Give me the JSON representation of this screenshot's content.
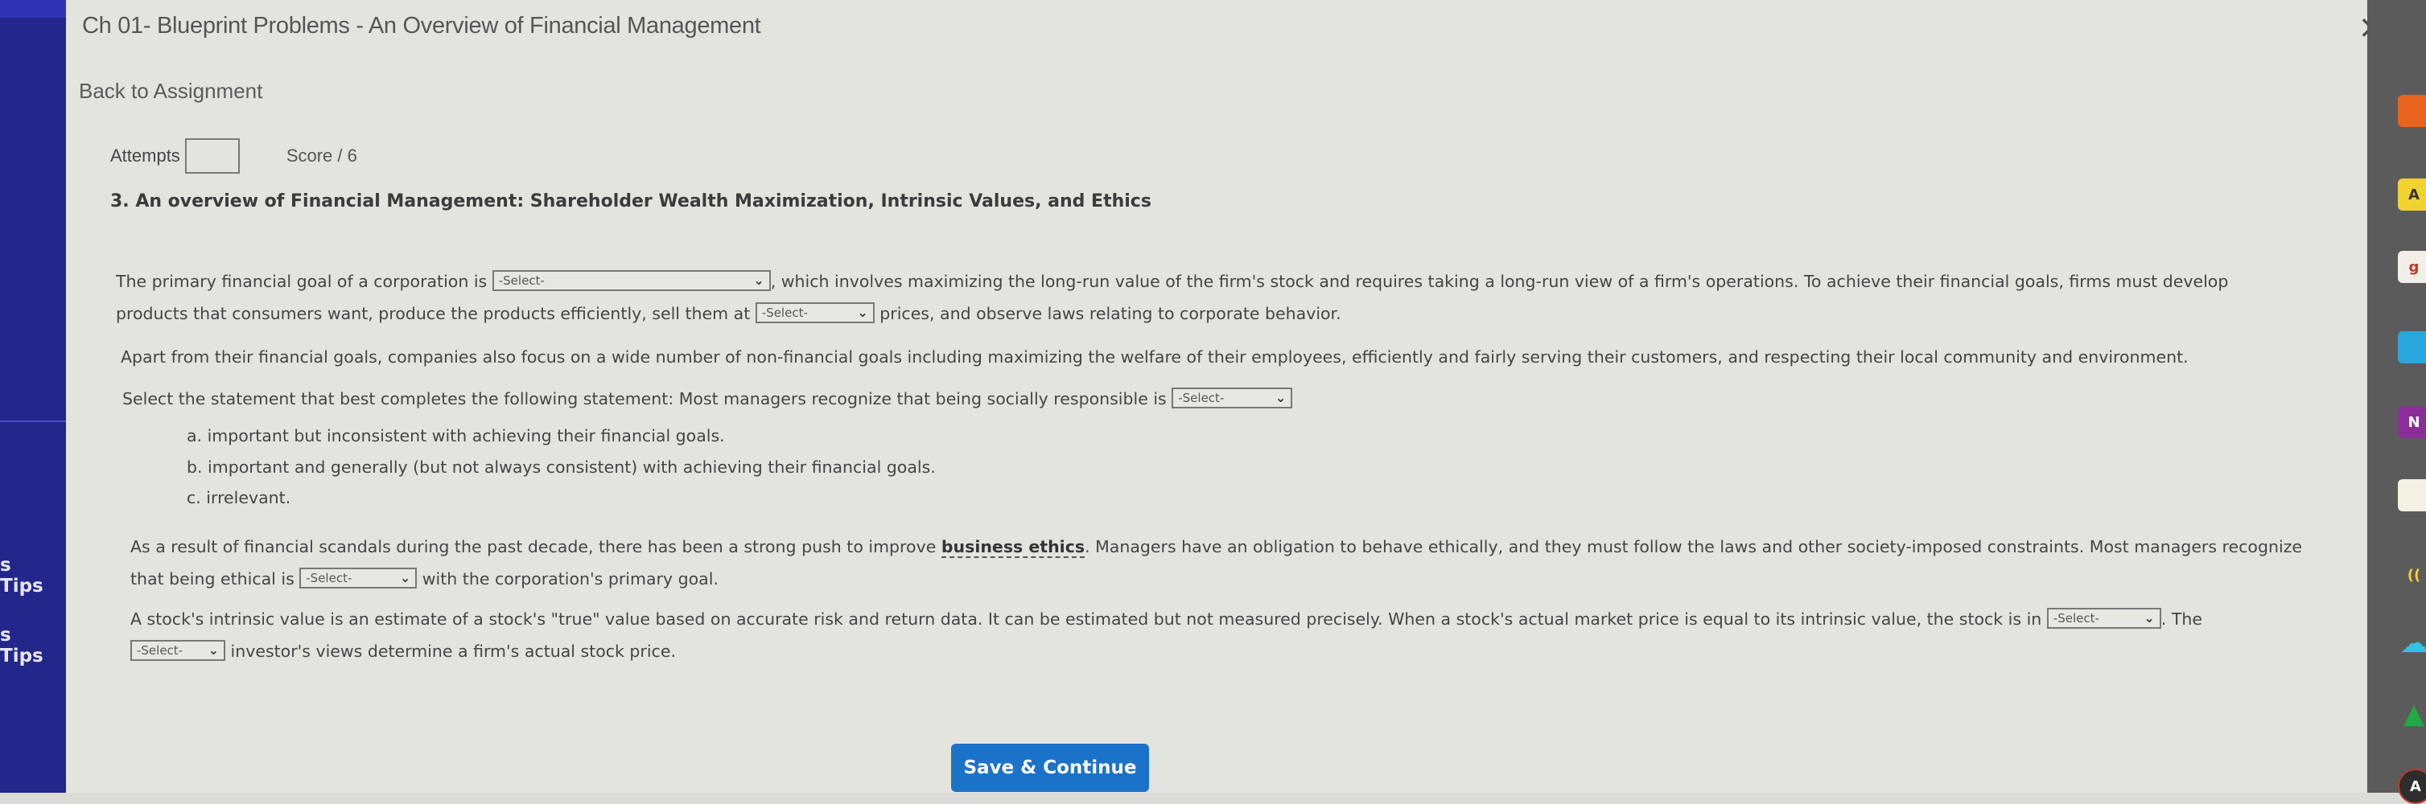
{
  "sidebar": {
    "tips": [
      "s Tips",
      "s Tips"
    ]
  },
  "modal": {
    "title": "Ch 01- Blueprint Problems - An Overview of Financial Management",
    "close_icon": "×",
    "back_link": "Back to Assignment",
    "attempts_label": "Attempts",
    "attempts_value": "",
    "score_label": "Score / 6"
  },
  "question": {
    "title": "3.  An overview of Financial Management: Shareholder Wealth Maximization, Intrinsic Values, and Ethics",
    "p1": {
      "a": "The primary financial goal of a corporation is ",
      "b": ", which involves maximizing the long-run value of the firm's stock and requires taking a long-run view of a firm's operations. To achieve their financial goals, firms must develop",
      "c": "products that consumers want, produce the products efficiently, sell them at ",
      "d": " prices, and observe laws relating to corporate behavior."
    },
    "p2": "Apart from their financial goals, companies also focus on a wide number of non-financial goals including maximizing the welfare of their employees, efficiently and fairly serving their customers, and respecting their local community and environment.",
    "p3": "Select the statement that best completes the following statement: Most managers recognize that being socially responsible is ",
    "options": [
      "a. important but inconsistent with achieving their financial goals.",
      "b. important and generally (but not always consistent) with achieving their financial goals.",
      "c. irrelevant."
    ],
    "p4": {
      "a": "As a result of financial scandals during the past decade, there has been a strong push to improve ",
      "term": "business ethics",
      "b": ". Managers have an obligation to behave ethically, and they must follow the laws and other society-imposed constraints. Most managers recognize",
      "c": "that being ethical is ",
      "d": " with the corporation's primary goal."
    },
    "p5": {
      "a": "A stock's intrinsic value is an estimate of a stock's \"true\" value based on accurate risk and return data. It can be estimated but not measured precisely. When a stock's actual market price is equal to its intrinsic value, the stock is in ",
      "b": ". The",
      "c": " investor's views determine a firm's actual stock price."
    },
    "select_placeholder": "-Select-",
    "chevron": "⌄"
  },
  "actions": {
    "save_continue": "Save & Continue"
  },
  "taskbar": {
    "icons": [
      {
        "name": "app-icon-1",
        "glyph": "",
        "color": "#e8641c"
      },
      {
        "name": "app-icon-a",
        "glyph": "A",
        "color": "#f2d22e"
      },
      {
        "name": "app-icon-office",
        "glyph": "g",
        "color": "#f1efe8"
      },
      {
        "name": "app-icon-book",
        "glyph": "",
        "color": "#2aa7df"
      },
      {
        "name": "onenote-icon",
        "glyph": "N",
        "color": "#8a2f98"
      },
      {
        "name": "app-icon-note",
        "glyph": "",
        "color": "#f4f0e4"
      },
      {
        "name": "wireless-icon",
        "glyph": "((",
        "color": "#5b5b5b"
      },
      {
        "name": "onedrive-icon",
        "glyph": "☁",
        "color": "#5b5b5b"
      },
      {
        "name": "google-drive-icon",
        "glyph": "▲",
        "color": "#5b5b5b"
      },
      {
        "name": "app-icon-bottom",
        "glyph": "A",
        "color": "#2d2d2d"
      }
    ]
  }
}
